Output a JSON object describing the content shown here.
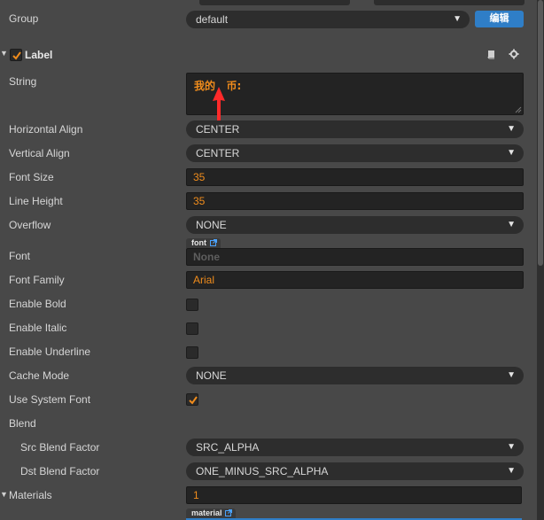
{
  "group": {
    "label": "Group",
    "value": "default",
    "edit_button": "编辑"
  },
  "component": {
    "title": "Label"
  },
  "props": {
    "string": {
      "label": "String",
      "value": "我的   币:"
    },
    "h_align": {
      "label": "Horizontal Align",
      "value": "CENTER"
    },
    "v_align": {
      "label": "Vertical Align",
      "value": "CENTER"
    },
    "font_size": {
      "label": "Font Size",
      "value": "35"
    },
    "line_height": {
      "label": "Line Height",
      "value": "35"
    },
    "overflow": {
      "label": "Overflow",
      "value": "NONE"
    },
    "font": {
      "label": "Font",
      "tag": "font",
      "placeholder": "None"
    },
    "font_family": {
      "label": "Font Family",
      "value": "Arial"
    },
    "bold": {
      "label": "Enable Bold",
      "checked": false
    },
    "italic": {
      "label": "Enable Italic",
      "checked": false
    },
    "underline": {
      "label": "Enable Underline",
      "checked": false
    },
    "cache_mode": {
      "label": "Cache Mode",
      "value": "NONE"
    },
    "system_font": {
      "label": "Use System Font",
      "checked": true
    },
    "blend": {
      "label": "Blend"
    },
    "src_blend": {
      "label": "Src Blend Factor",
      "value": "SRC_ALPHA"
    },
    "dst_blend": {
      "label": "Dst Blend Factor",
      "value": "ONE_MINUS_SRC_ALPHA"
    },
    "materials": {
      "label": "Materials",
      "value": "1",
      "tag": "material"
    }
  },
  "colors": {
    "accent": "#f08c1c",
    "button": "#2f7ec7",
    "annotation_arrow": "#ff2a2a"
  }
}
